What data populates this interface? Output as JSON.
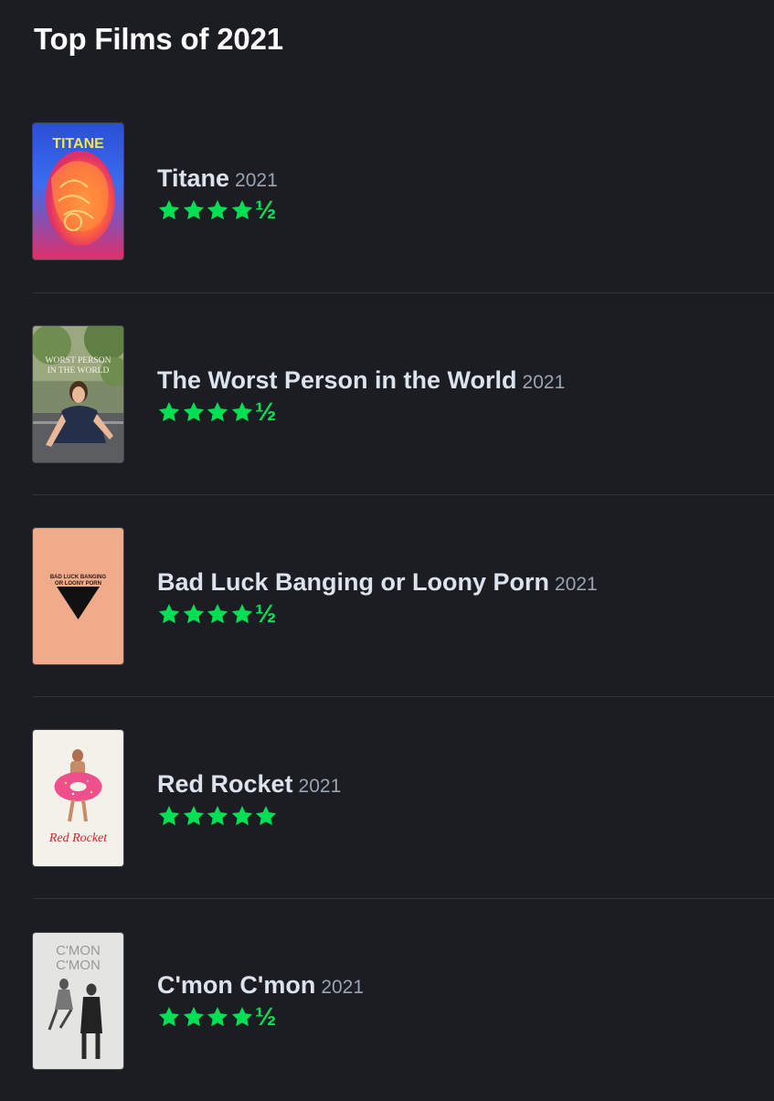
{
  "header": {
    "title": "Top Films of 2021"
  },
  "colors": {
    "background": "#1b1d22",
    "star_green": "#00e054",
    "divider": "#2f343c"
  },
  "films": [
    {
      "title": "Titane",
      "year": "2021",
      "rating": 4.5,
      "half_label": "½",
      "poster_text": "TITANE",
      "poster_icon": "titane-poster"
    },
    {
      "title": "The Worst Person in the World",
      "year": "2021",
      "rating": 4.5,
      "half_label": "½",
      "poster_text_line1": "WORST PERSON",
      "poster_text_line2": "IN THE WORLD",
      "poster_icon": "worst-person-poster"
    },
    {
      "title": "Bad Luck Banging or Loony Porn",
      "year": "2021",
      "rating": 4.5,
      "half_label": "½",
      "poster_text_line1": "BAD LUCK BANGING",
      "poster_text_line2": "OR LOONY PORN",
      "poster_icon": "bad-luck-banging-poster"
    },
    {
      "title": "Red Rocket",
      "year": "2021",
      "rating": 5,
      "half_label": "",
      "poster_text": "Red Rocket",
      "poster_icon": "red-rocket-poster"
    },
    {
      "title": "C'mon C'mon",
      "year": "2021",
      "rating": 4.5,
      "half_label": "½",
      "poster_text_line1": "C'MON",
      "poster_text_line2": "C'MON",
      "poster_icon": "cmon-cmon-poster"
    }
  ]
}
